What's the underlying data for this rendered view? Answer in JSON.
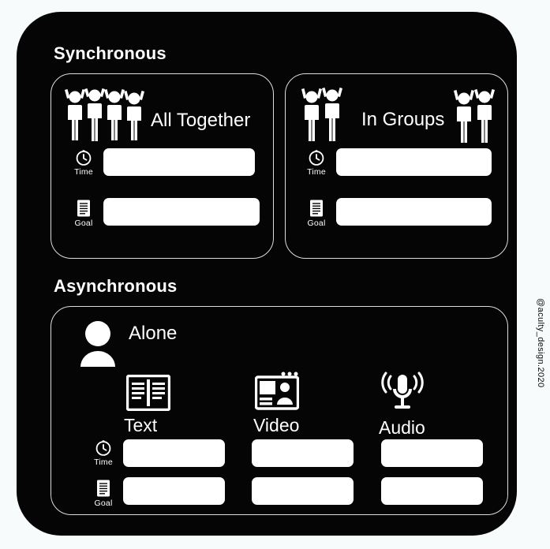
{
  "meta": {
    "credit": "@aculty_design.2020",
    "colors": {
      "background": "#f7fbfb",
      "board": "#050505",
      "stroke": "#d9dede",
      "field": "#ffffff",
      "text": "#ffffff"
    }
  },
  "sections": [
    {
      "id": "synchronous",
      "title": "Synchronous"
    },
    {
      "id": "asynchronous",
      "title": "Asynchronous"
    }
  ],
  "panels": [
    {
      "id": "all-together",
      "label": "All Together",
      "icon": "group-of-four-people-icon",
      "rows": [
        {
          "id": "time",
          "caption": "Time",
          "icon": "clock-icon",
          "value": ""
        },
        {
          "id": "goal",
          "caption": "Goal",
          "icon": "list-document-icon",
          "value": ""
        }
      ]
    },
    {
      "id": "in-groups",
      "label": "In Groups",
      "icon": "two-small-groups-icon",
      "rows": [
        {
          "id": "time",
          "caption": "Time",
          "icon": "clock-icon",
          "value": ""
        },
        {
          "id": "goal",
          "caption": "Goal",
          "icon": "list-document-icon",
          "value": ""
        }
      ]
    },
    {
      "id": "alone",
      "label": "Alone",
      "icon": "single-person-icon",
      "media": [
        {
          "id": "text",
          "label": "Text",
          "icon": "open-book-icon"
        },
        {
          "id": "video",
          "label": "Video",
          "icon": "video-window-icon"
        },
        {
          "id": "audio",
          "label": "Audio",
          "icon": "microphone-icon"
        }
      ],
      "rows": [
        {
          "id": "time",
          "caption": "Time",
          "icon": "clock-icon"
        },
        {
          "id": "goal",
          "caption": "Goal",
          "icon": "list-document-icon"
        }
      ]
    }
  ]
}
